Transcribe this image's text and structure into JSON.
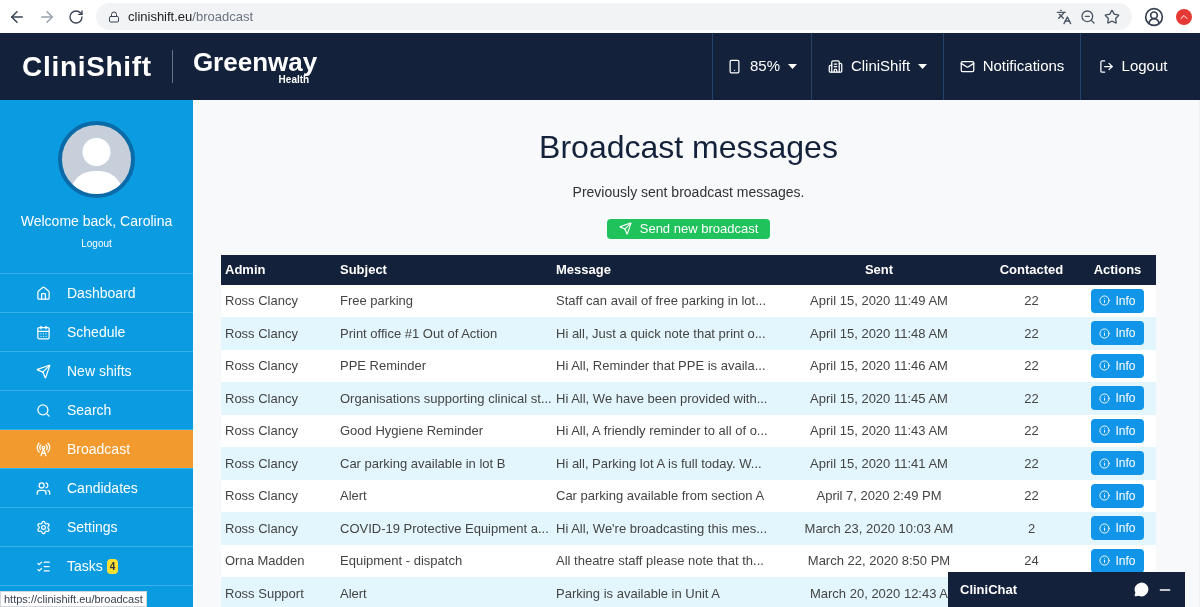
{
  "browser": {
    "url_host": "clinishift.eu",
    "url_path": "/broadcast"
  },
  "header": {
    "logo": "CliniShift",
    "partner_name": "Greenway",
    "partner_sub": "Health",
    "nav": [
      {
        "label": "85%",
        "caret": true
      },
      {
        "label": "CliniShift",
        "caret": true
      },
      {
        "label": "Notifications",
        "caret": false
      },
      {
        "label": "Logout",
        "caret": false
      }
    ]
  },
  "sidebar": {
    "welcome": "Welcome back, Carolina",
    "logout": "Logout",
    "items": [
      {
        "label": "Dashboard",
        "selected": false
      },
      {
        "label": "Schedule",
        "selected": false
      },
      {
        "label": "New shifts",
        "selected": false
      },
      {
        "label": "Search",
        "selected": false
      },
      {
        "label": "Broadcast",
        "selected": true
      },
      {
        "label": "Candidates",
        "selected": false
      },
      {
        "label": "Settings",
        "selected": false
      },
      {
        "label": "Tasks",
        "selected": false,
        "badge": "4"
      }
    ]
  },
  "main": {
    "title": "Broadcast messages",
    "subtitle": "Previously sent broadcast messages.",
    "send_button": "Send new broadcast"
  },
  "table": {
    "columns": [
      "Admin",
      "Subject",
      "Message",
      "Sent",
      "Contacted",
      "Actions"
    ],
    "rows": [
      {
        "admin": "Ross Clancy",
        "subject": "Free parking",
        "message": "Staff can avail of free parking in lot...",
        "sent": "April 15, 2020 11:49 AM",
        "contacted": "22",
        "action": "Info"
      },
      {
        "admin": "Ross Clancy",
        "subject": "Print office #1 Out of Action",
        "message": "Hi all, Just a quick note that print o...",
        "sent": "April 15, 2020 11:48 AM",
        "contacted": "22",
        "action": "Info"
      },
      {
        "admin": "Ross Clancy",
        "subject": "PPE Reminder",
        "message": "Hi All, Reminder that PPE is availa...",
        "sent": "April 15, 2020 11:46 AM",
        "contacted": "22",
        "action": "Info"
      },
      {
        "admin": "Ross Clancy",
        "subject": "Organisations supporting clinical st...",
        "message": "Hi All, We have been provided with...",
        "sent": "April 15, 2020 11:45 AM",
        "contacted": "22",
        "action": "Info"
      },
      {
        "admin": "Ross Clancy",
        "subject": "Good Hygiene Reminder",
        "message": "Hi All, A friendly reminder to all of o...",
        "sent": "April 15, 2020 11:43 AM",
        "contacted": "22",
        "action": "Info"
      },
      {
        "admin": "Ross Clancy",
        "subject": "Car parking available in lot B",
        "message": "Hi all, Parking lot A is full today. W...",
        "sent": "April 15, 2020 11:41 AM",
        "contacted": "22",
        "action": "Info"
      },
      {
        "admin": "Ross Clancy",
        "subject": "Alert",
        "message": "Car parking available from section A",
        "sent": "April 7, 2020 2:49 PM",
        "contacted": "22",
        "action": "Info"
      },
      {
        "admin": "Ross Clancy",
        "subject": "COVID-19 Protective Equipment a...",
        "message": "Hi All, We're broadcasting this mes...",
        "sent": "March 23, 2020 10:03 AM",
        "contacted": "2",
        "action": "Info"
      },
      {
        "admin": "Orna Madden",
        "subject": "Equipment - dispatch",
        "message": "All theatre staff please note that th...",
        "sent": "March 22, 2020 8:50 PM",
        "contacted": "24",
        "action": "Info"
      },
      {
        "admin": "Ross Support",
        "subject": "Alert",
        "message": "Parking is available in Unit A",
        "sent": "March 20, 2020 12:43 A"
      }
    ]
  },
  "chat": {
    "title": "CliniChat"
  },
  "status_url": "https://clinishift.eu/broadcast"
}
